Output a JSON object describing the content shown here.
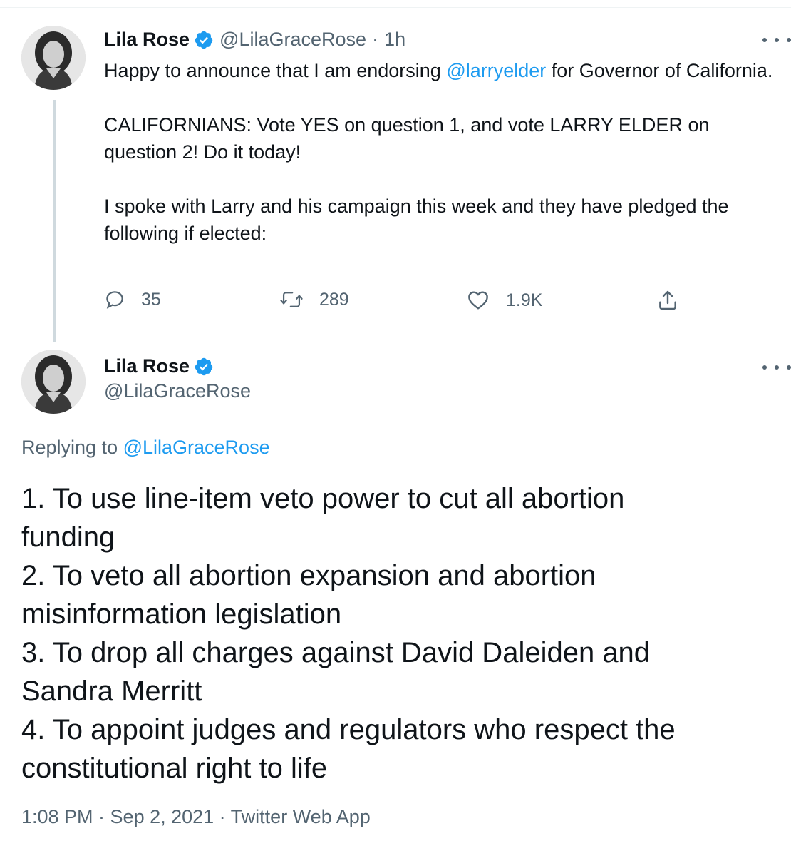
{
  "tweet1": {
    "author_name": "Lila Rose",
    "handle": "@LilaGraceRose",
    "separator": "·",
    "time": "1h",
    "text_line1_before": "Happy to announce that I am endorsing ",
    "mention": "@larryelder",
    "text_line1_after": " for Governor of California.",
    "paragraph2": "CALIFORNIANS: Vote YES on question 1, and vote LARRY ELDER on question 2! Do it today!",
    "paragraph3": "I spoke with Larry and his campaign this week and they have pledged the following if elected:",
    "reply_count": "35",
    "retweet_count": "289",
    "like_count": "1.9K",
    "reply_icon": "reply-icon",
    "retweet_icon": "retweet-icon",
    "like_icon": "heart-icon",
    "share_icon": "share-icon"
  },
  "tweet2": {
    "author_name": "Lila Rose",
    "handle": "@LilaGraceRose",
    "replying_prefix": "Replying to ",
    "replying_to": "@LilaGraceRose",
    "items": [
      "1. To use line-item veto power to cut all abortion funding",
      "2. To veto all abortion expansion and abortion misinformation legislation",
      "3. To drop all charges against David Daleiden and Sandra Merritt",
      "4. To appoint judges and regulators who respect the constitutional right to life"
    ],
    "footer": "1:08 PM · Sep 2, 2021 · Twitter Web App"
  },
  "colors": {
    "accent": "#1d9bf0",
    "text": "#0f1419",
    "secondary": "#536471"
  }
}
